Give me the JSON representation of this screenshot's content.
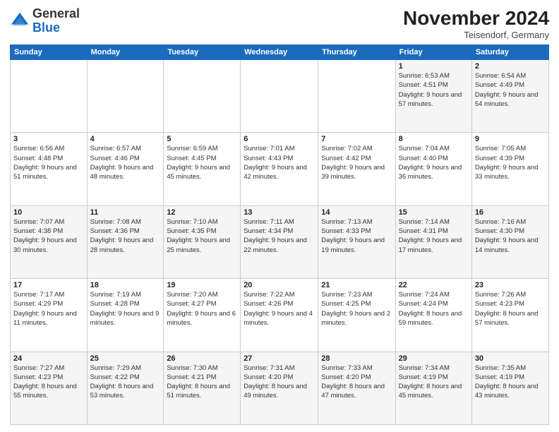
{
  "logo": {
    "general": "General",
    "blue": "Blue"
  },
  "header": {
    "title": "November 2024",
    "location": "Teisendorf, Germany"
  },
  "weekdays": [
    "Sunday",
    "Monday",
    "Tuesday",
    "Wednesday",
    "Thursday",
    "Friday",
    "Saturday"
  ],
  "weeks": [
    [
      {
        "day": "",
        "info": ""
      },
      {
        "day": "",
        "info": ""
      },
      {
        "day": "",
        "info": ""
      },
      {
        "day": "",
        "info": ""
      },
      {
        "day": "",
        "info": ""
      },
      {
        "day": "1",
        "info": "Sunrise: 6:53 AM\nSunset: 4:51 PM\nDaylight: 9 hours and 57 minutes."
      },
      {
        "day": "2",
        "info": "Sunrise: 6:54 AM\nSunset: 4:49 PM\nDaylight: 9 hours and 54 minutes."
      }
    ],
    [
      {
        "day": "3",
        "info": "Sunrise: 6:56 AM\nSunset: 4:48 PM\nDaylight: 9 hours and 51 minutes."
      },
      {
        "day": "4",
        "info": "Sunrise: 6:57 AM\nSunset: 4:46 PM\nDaylight: 9 hours and 48 minutes."
      },
      {
        "day": "5",
        "info": "Sunrise: 6:59 AM\nSunset: 4:45 PM\nDaylight: 9 hours and 45 minutes."
      },
      {
        "day": "6",
        "info": "Sunrise: 7:01 AM\nSunset: 4:43 PM\nDaylight: 9 hours and 42 minutes."
      },
      {
        "day": "7",
        "info": "Sunrise: 7:02 AM\nSunset: 4:42 PM\nDaylight: 9 hours and 39 minutes."
      },
      {
        "day": "8",
        "info": "Sunrise: 7:04 AM\nSunset: 4:40 PM\nDaylight: 9 hours and 36 minutes."
      },
      {
        "day": "9",
        "info": "Sunrise: 7:05 AM\nSunset: 4:39 PM\nDaylight: 9 hours and 33 minutes."
      }
    ],
    [
      {
        "day": "10",
        "info": "Sunrise: 7:07 AM\nSunset: 4:38 PM\nDaylight: 9 hours and 30 minutes."
      },
      {
        "day": "11",
        "info": "Sunrise: 7:08 AM\nSunset: 4:36 PM\nDaylight: 9 hours and 28 minutes."
      },
      {
        "day": "12",
        "info": "Sunrise: 7:10 AM\nSunset: 4:35 PM\nDaylight: 9 hours and 25 minutes."
      },
      {
        "day": "13",
        "info": "Sunrise: 7:11 AM\nSunset: 4:34 PM\nDaylight: 9 hours and 22 minutes."
      },
      {
        "day": "14",
        "info": "Sunrise: 7:13 AM\nSunset: 4:33 PM\nDaylight: 9 hours and 19 minutes."
      },
      {
        "day": "15",
        "info": "Sunrise: 7:14 AM\nSunset: 4:31 PM\nDaylight: 9 hours and 17 minutes."
      },
      {
        "day": "16",
        "info": "Sunrise: 7:16 AM\nSunset: 4:30 PM\nDaylight: 9 hours and 14 minutes."
      }
    ],
    [
      {
        "day": "17",
        "info": "Sunrise: 7:17 AM\nSunset: 4:29 PM\nDaylight: 9 hours and 11 minutes."
      },
      {
        "day": "18",
        "info": "Sunrise: 7:19 AM\nSunset: 4:28 PM\nDaylight: 9 hours and 9 minutes."
      },
      {
        "day": "19",
        "info": "Sunrise: 7:20 AM\nSunset: 4:27 PM\nDaylight: 9 hours and 6 minutes."
      },
      {
        "day": "20",
        "info": "Sunrise: 7:22 AM\nSunset: 4:26 PM\nDaylight: 9 hours and 4 minutes."
      },
      {
        "day": "21",
        "info": "Sunrise: 7:23 AM\nSunset: 4:25 PM\nDaylight: 9 hours and 2 minutes."
      },
      {
        "day": "22",
        "info": "Sunrise: 7:24 AM\nSunset: 4:24 PM\nDaylight: 8 hours and 59 minutes."
      },
      {
        "day": "23",
        "info": "Sunrise: 7:26 AM\nSunset: 4:23 PM\nDaylight: 8 hours and 57 minutes."
      }
    ],
    [
      {
        "day": "24",
        "info": "Sunrise: 7:27 AM\nSunset: 4:23 PM\nDaylight: 8 hours and 55 minutes."
      },
      {
        "day": "25",
        "info": "Sunrise: 7:29 AM\nSunset: 4:22 PM\nDaylight: 8 hours and 53 minutes."
      },
      {
        "day": "26",
        "info": "Sunrise: 7:30 AM\nSunset: 4:21 PM\nDaylight: 8 hours and 51 minutes."
      },
      {
        "day": "27",
        "info": "Sunrise: 7:31 AM\nSunset: 4:20 PM\nDaylight: 8 hours and 49 minutes."
      },
      {
        "day": "28",
        "info": "Sunrise: 7:33 AM\nSunset: 4:20 PM\nDaylight: 8 hours and 47 minutes."
      },
      {
        "day": "29",
        "info": "Sunrise: 7:34 AM\nSunset: 4:19 PM\nDaylight: 8 hours and 45 minutes."
      },
      {
        "day": "30",
        "info": "Sunrise: 7:35 AM\nSunset: 4:19 PM\nDaylight: 8 hours and 43 minutes."
      }
    ]
  ]
}
